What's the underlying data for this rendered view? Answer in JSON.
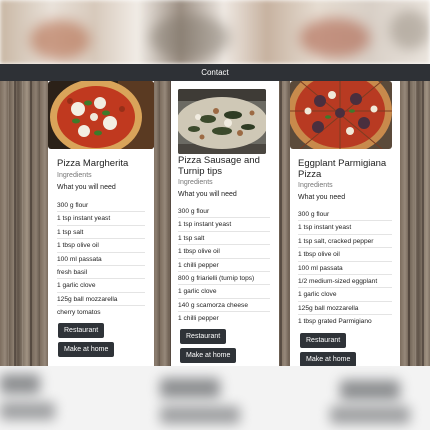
{
  "nav": {
    "contact_label": "Contact"
  },
  "cards": [
    {
      "title": "Pizza Margherita",
      "subtitle": "Ingredients",
      "intro": "What you will need",
      "ingredients": [
        "300 g flour",
        "1 tsp instant yeast",
        "1 tsp salt",
        "1 tbsp olive oil",
        "100 ml passata",
        "fresh basil",
        "1 garlic clove",
        "125g ball mozzarella",
        "cherry tomatos"
      ],
      "restaurant_label": "Restaurant",
      "home_label": "Make at home"
    },
    {
      "title": "Pizza Sausage and Turnip tips",
      "subtitle": "Ingredients",
      "intro": "What you will need",
      "ingredients": [
        "300 g flour",
        "1 tsp instant yeast",
        "1 tsp salt",
        "1 tbsp olive oil",
        "1 chilli pepper",
        "800 g friarielli (turnip tops)",
        "1 garlic clove",
        "140 g scamorza cheese",
        "1 chilli pepper"
      ],
      "restaurant_label": "Restaurant",
      "home_label": "Make at home"
    },
    {
      "title": "Eggplant Parmigiana Pizza",
      "subtitle": "Ingredients",
      "intro": "What you need",
      "ingredients": [
        "300 g flour",
        "1 tsp instant yeast",
        "1 tsp salt, cracked pepper",
        "1 tbsp olive oil",
        "100 ml passata",
        "1/2 medium-sized eggplant",
        "1 garlic clove",
        "125g ball mozzarella",
        "1 tbsp grated Parmigiano"
      ],
      "restaurant_label": "Restaurant",
      "home_label": "Make at home"
    }
  ]
}
